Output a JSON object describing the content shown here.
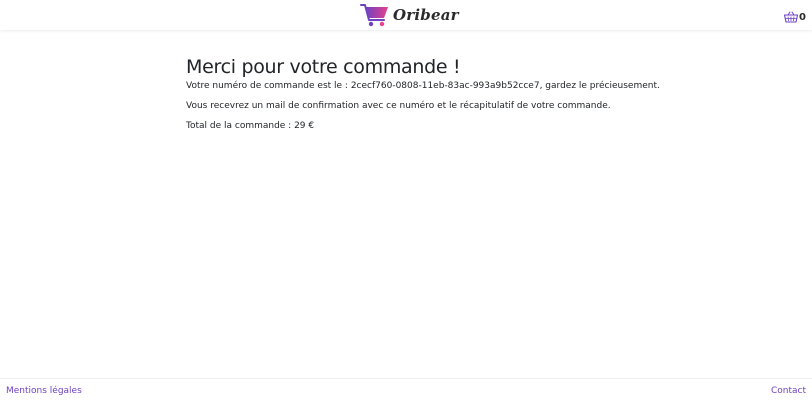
{
  "header": {
    "brand": "Oribear",
    "logo_icon": "shopping-cart-icon",
    "basket_icon": "basket-icon",
    "cart_count": "0",
    "colors": {
      "cart_gradient_start": "#6f42c1",
      "cart_gradient_end": "#e83e8c",
      "basket": "#6f42c1"
    }
  },
  "main": {
    "title": "Merci pour votre commande !",
    "order_line": "Votre numéro de commande est le : 2cecf760-0808-11eb-83ac-993a9b52cce7, gardez le précieusement.",
    "mail_line": "Vous recevrez un mail de confirmation avec ce numéro et le récapitulatif de votre commande.",
    "total_line": "Total de la commande : 29 €"
  },
  "footer": {
    "legal_link": "Mentions légales",
    "contact_link": "Contact",
    "link_color": "#6f42c1"
  }
}
